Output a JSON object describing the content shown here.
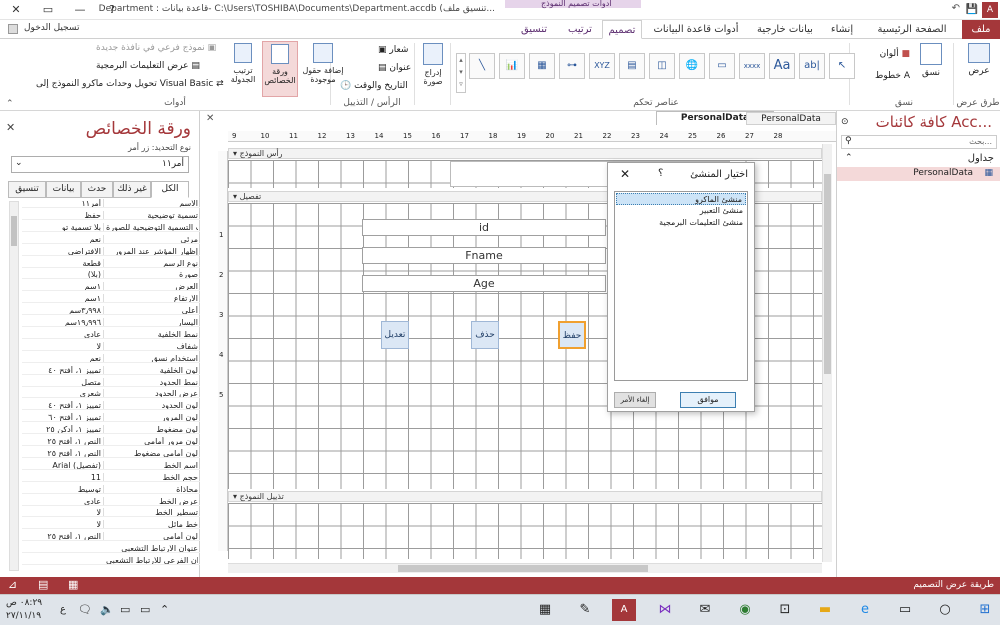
{
  "titlebar": {
    "title": "Department : قاعدة بيانات- C:\\Users\\TOSHIBA\\Documents\\Department.accdb (تنسيق ملف...",
    "signin": "تسجيل الدخول",
    "context_group": "أدوات تصميم النموذج",
    "help": "?",
    "minimize": "—",
    "restore": "▭",
    "close": "✕"
  },
  "ribbon_tabs": {
    "file": "ملف",
    "home": "الصفحة الرئيسية",
    "create": "إنشاء",
    "external": "بيانات خارجية",
    "dbtools": "أدوات قاعدة البيانات",
    "design": "تصميم",
    "arrange": "ترتيب",
    "format": "تنسيق"
  },
  "ribbon": {
    "views": {
      "label": "عرض",
      "group": "طرق عرض"
    },
    "themes": {
      "themes": "نسق",
      "colors": "ألوان",
      "fonts": "خطوط",
      "group": "نسق"
    },
    "controls": {
      "group": "عناصر تحكم",
      "xyz": "XYZ",
      "aa": "Aa",
      "ab": "ab|",
      "xxxx": "xxxx"
    },
    "insert_image": "إدراج صورة",
    "header": {
      "logo": "شعار",
      "title": "عنوان",
      "datetime": "التاريخ والوقت",
      "group": "الرأس / التذييل"
    },
    "tools": {
      "add_fields": "إضافة حقول موجودة",
      "property_sheet": "ورقة الخصائص",
      "tab_order": "ترتيب الجدولة",
      "subform": "نموذج فرعي في نافذة جديدة",
      "view_code": "عرض التعليمات البرمجية",
      "convert_macros": "تحويل وحدات ماكرو النموذج إلى Visual Basic",
      "group": "أدوات"
    }
  },
  "props": {
    "title": "ورقة الخصائص",
    "selection_type": "نوع التحديد: زر أمر",
    "selected": "أمر١١",
    "tabs": {
      "all": "الكل",
      "other": "غير ذلك",
      "event": "حدث",
      "data": "بيانات",
      "format": "تنسيق"
    },
    "rows": [
      {
        "k": "الاسم",
        "v": "أمر١١"
      },
      {
        "k": "تسمية توضيحية",
        "v": "حفظ"
      },
      {
        "k": "ترتيب التسمية التوضيحية للصورة",
        "v": "بلا تسمية تو"
      },
      {
        "k": "مرئي",
        "v": "نعم"
      },
      {
        "k": "إظهار المؤشر عند المرور",
        "v": "الافتراضي"
      },
      {
        "k": "نوع الرسم",
        "v": "قطعة"
      },
      {
        "k": "صورة",
        "v": "(بلا)"
      },
      {
        "k": "العرض",
        "v": "١سم"
      },
      {
        "k": "الارتفاع",
        "v": "١سم"
      },
      {
        "k": "أعلى",
        "v": "٣٫٩٩٨سم"
      },
      {
        "k": "اليسار",
        "v": "١٩٫٩٩٦سم"
      },
      {
        "k": "نمط الخلفية",
        "v": "عادي"
      },
      {
        "k": "شفاف",
        "v": "لا"
      },
      {
        "k": "استخدام نسق",
        "v": "نعم"
      },
      {
        "k": "لون الخلفية",
        "v": "تمييز ١، أفتح ٤٠"
      },
      {
        "k": "نمط الحدود",
        "v": "متصل"
      },
      {
        "k": "عرض الحدود",
        "v": "شعري"
      },
      {
        "k": "لون الحدود",
        "v": "تمييز ١، أفتح ٤٠"
      },
      {
        "k": "لون المرور",
        "v": "تمييز ١، أفتح ٦٠"
      },
      {
        "k": "لون مضغوط",
        "v": "تمييز ١، أدكن ٢٥"
      },
      {
        "k": "لون مرور أمامي",
        "v": "النص ١، أفتح ٢٥"
      },
      {
        "k": "لون أمامي مضغوط",
        "v": "النص ١، أفتح ٢٥"
      },
      {
        "k": "اسم الخط",
        "v": "Arial (تفصيل)"
      },
      {
        "k": "حجم الخط",
        "v": "11"
      },
      {
        "k": "محاذاة",
        "v": "توسيط"
      },
      {
        "k": "عرض الخط",
        "v": "عادي"
      },
      {
        "k": "تسطير الخط",
        "v": "لا"
      },
      {
        "k": "خط مائل",
        "v": "لا"
      },
      {
        "k": "لون أمامي",
        "v": "النص ١، أفتح ٢٥"
      },
      {
        "k": "عنوان الارتباط التشعبي",
        "v": ""
      },
      {
        "k": "العنوان الفرعي للارتباط التشعبي",
        "v": ""
      }
    ]
  },
  "design": {
    "form_header": "رأس النموذج",
    "detail": "تفصيل",
    "form_footer": "تذييل النموذج",
    "header_title": "PersonalD",
    "fields": [
      "id",
      "Fname",
      "Age"
    ],
    "buttons": {
      "edit": "تعديل",
      "delete": "حذف",
      "save": "حفظ"
    },
    "tabs": [
      {
        "label": "PersonalData",
        "active": true
      },
      {
        "label": "PersonalData",
        "active": false
      }
    ],
    "ruler": [
      "9",
      "10",
      "11",
      "12",
      "13",
      "14",
      "15",
      "16",
      "17",
      "18",
      "19",
      "20",
      "21",
      "22",
      "23",
      "24",
      "25",
      "26",
      "27",
      "28"
    ],
    "vruler": [
      "1",
      "2",
      "3",
      "4",
      "5"
    ]
  },
  "nav": {
    "title": "كافة كائنات Acc...",
    "search_placeholder": "بحث...",
    "group": "جداول",
    "item": "PersonalData"
  },
  "dialog": {
    "title": "اختيار المنشئ",
    "help": "؟",
    "close": "✕",
    "options": [
      "منشئ الماكرو",
      "منشئ التعبير",
      "منشئ التعليمات البرمجية"
    ],
    "ok": "موافق",
    "cancel": "إلغاء الأمر"
  },
  "status": {
    "text": "طريقة عرض التصميم"
  },
  "taskbar": {
    "time": "٠٨:٢٩ ص",
    "date": "٢٧/١١/١٩",
    "lang": "ع"
  },
  "colors": {
    "accent": "#a4373a",
    "ctx": "#e6d4ea",
    "select": "#cde4f7"
  }
}
